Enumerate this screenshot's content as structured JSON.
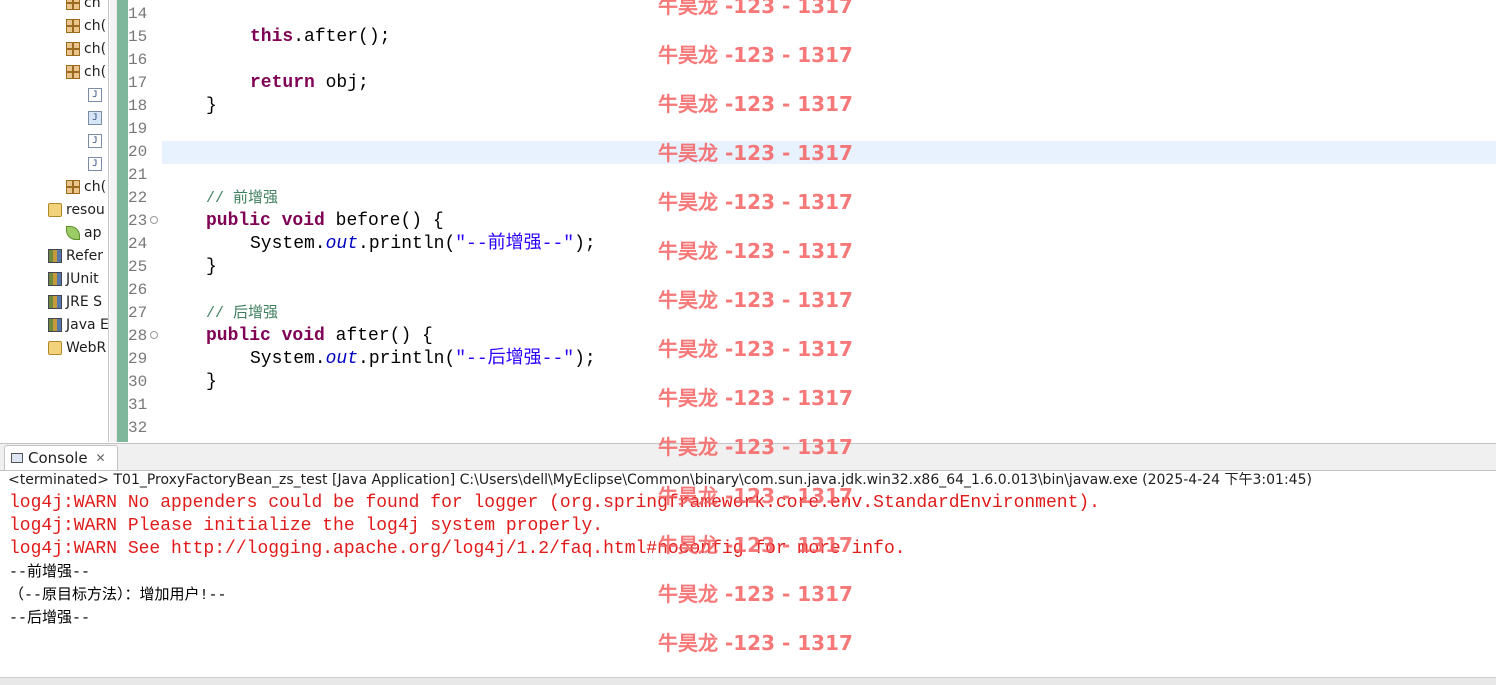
{
  "explorer": {
    "items": [
      {
        "type": "package",
        "label": "ch"
      },
      {
        "type": "package",
        "label": "ch("
      },
      {
        "type": "package",
        "label": "ch("
      },
      {
        "type": "package",
        "label": "ch("
      },
      {
        "type": "java",
        "label": "J"
      },
      {
        "type": "java",
        "label": "J"
      },
      {
        "type": "java",
        "label": "J"
      },
      {
        "type": "java",
        "label": "J"
      },
      {
        "type": "package",
        "label": "ch("
      },
      {
        "type": "folder",
        "label": "resou"
      },
      {
        "type": "leaf",
        "label": "ap"
      },
      {
        "type": "library",
        "label": "Refer"
      },
      {
        "type": "library",
        "label": "JUnit"
      },
      {
        "type": "library",
        "label": "JRE S"
      },
      {
        "type": "library",
        "label": "Java E"
      },
      {
        "type": "folder",
        "label": "WebR"
      }
    ]
  },
  "editor": {
    "line_numbers": [
      "14",
      "15",
      "16",
      "17",
      "18",
      "19",
      "20",
      "21",
      "22",
      "23",
      "24",
      "25",
      "26",
      "27",
      "28",
      "29",
      "30",
      "31",
      "32"
    ],
    "code": {
      "l15_kw": "this",
      "l15_rest": ".after();",
      "l17_kw": "return",
      "l17_rest": " obj;",
      "l18": "}",
      "l22": "// 前增强",
      "l23_kw1": "public",
      "l23_kw2": "void",
      "l23_rest": " before() {",
      "l24_a": "System.",
      "l24_out": "out",
      "l24_b": ".println(",
      "l24_str": "\"--前增强--\"",
      "l24_c": ");",
      "l25": "}",
      "l27": "// 后增强",
      "l28_kw1": "public",
      "l28_kw2": "void",
      "l28_rest": " after() {",
      "l29_a": "System.",
      "l29_out": "out",
      "l29_b": ".println(",
      "l29_str": "\"--后增强--\"",
      "l29_c": ");",
      "l30": "}"
    }
  },
  "console": {
    "tab_label": "Console",
    "close_glyph": "✕",
    "terminated_line": "<terminated> T01_ProxyFactoryBean_zs_test [Java Application] C:\\Users\\dell\\MyEclipse\\Common\\binary\\com.sun.java.jdk.win32.x86_64_1.6.0.013\\bin\\javaw.exe (2025-4-24 下午3:01:45)",
    "output": [
      {
        "kind": "err",
        "text": "log4j:WARN No appenders could be found for logger (org.springframework.core.env.StandardEnvironment)."
      },
      {
        "kind": "err",
        "text": "log4j:WARN Please initialize the log4j system properly."
      },
      {
        "kind": "err",
        "text": "log4j:WARN See http://logging.apache.org/log4j/1.2/faq.html#noconfig for more info."
      },
      {
        "kind": "std",
        "text": "--前增强--"
      },
      {
        "kind": "std",
        "text": "（--原目标方法）：增加用户!--"
      },
      {
        "kind": "std",
        "text": "--后增强--"
      }
    ]
  },
  "watermark": {
    "text": "牛昊龙 -123 - 1317",
    "color": "#f46060"
  }
}
